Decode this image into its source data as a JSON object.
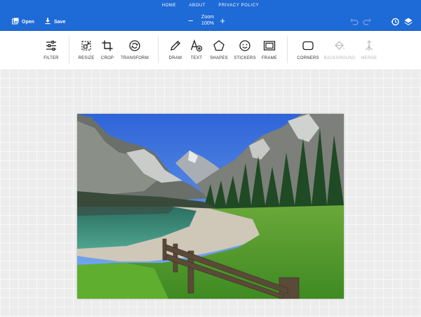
{
  "topnav": {
    "home": "HOME",
    "about": "ABOUT",
    "privacy": "PRIVACY POLICY"
  },
  "appbar": {
    "open_label": "Open",
    "save_label": "Save",
    "zoom_label": "Zoom",
    "zoom_value": "100%",
    "zoom_minus": "−",
    "zoom_plus": "+",
    "accent": "#1e6ad6"
  },
  "toolbar": {
    "filter": "FILTER",
    "resize": "RESIZE",
    "crop": "CROP",
    "transform": "TRANSFORM",
    "draw": "DRAW",
    "text": "TEXT",
    "shapes": "SHAPES",
    "stickers": "STICKERS",
    "frame": "FRAME",
    "corners": "CORNERS",
    "background": "BACKGROUND",
    "merge": "MERGE"
  },
  "icons": {
    "open": "open-image-icon",
    "save": "download-icon",
    "undo": "undo-icon",
    "redo": "redo-icon",
    "history": "history-icon",
    "layers": "layers-icon"
  }
}
